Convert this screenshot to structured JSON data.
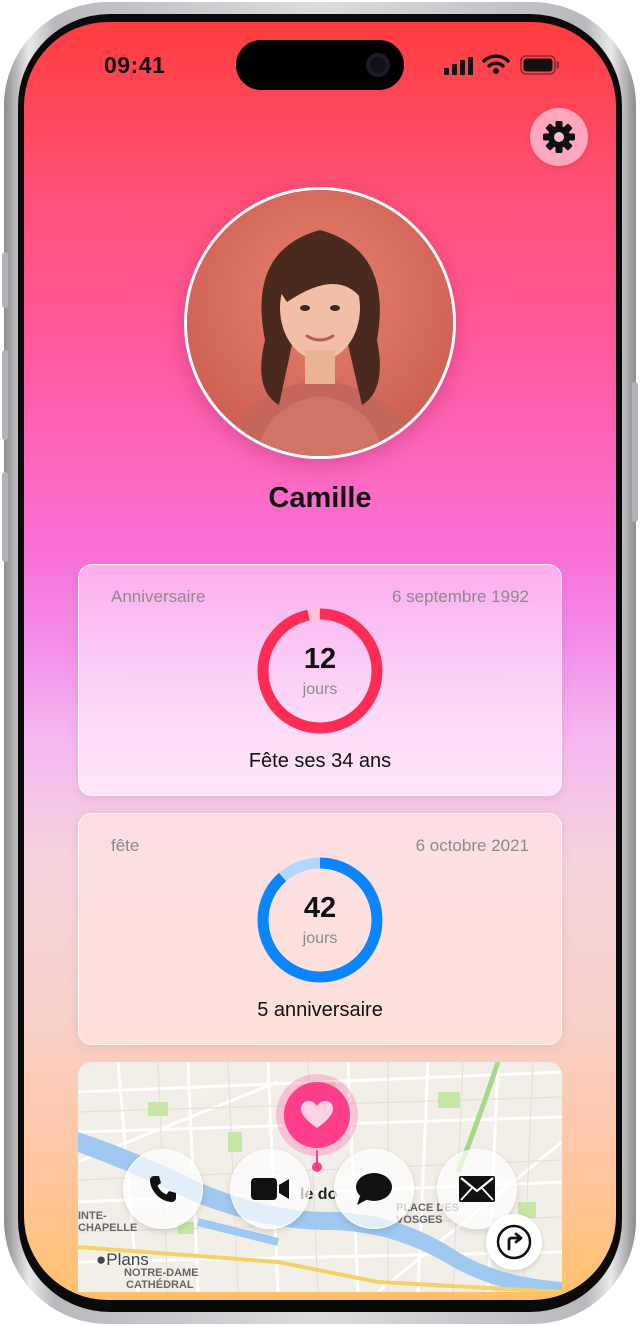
{
  "status_bar": {
    "time": "09:41"
  },
  "profile": {
    "name": "Camille"
  },
  "cards": [
    {
      "label": "Anniversaire",
      "date": "6 septembre 1992",
      "count": "12",
      "unit": "jours",
      "caption": "Fête ses 34 ans",
      "progress": 0.967,
      "color": "#ff2d55"
    },
    {
      "label": "fête",
      "date": "6 octobre 2021",
      "count": "42",
      "unit": "jours",
      "caption": "5 anniversaire",
      "progress": 0.885,
      "color": "#0a84ff"
    }
  ],
  "map": {
    "app_label": "Plans",
    "place_labels": [
      "INTE-",
      "CHAPELLE",
      "NOTRE-DAME",
      "CATHÉDRAL",
      "PLACE DES",
      "VOSGES"
    ],
    "partial_text": "le do"
  },
  "actions": {
    "call": "phone-icon",
    "video": "video-icon",
    "message": "message-icon",
    "mail": "mail-icon"
  }
}
